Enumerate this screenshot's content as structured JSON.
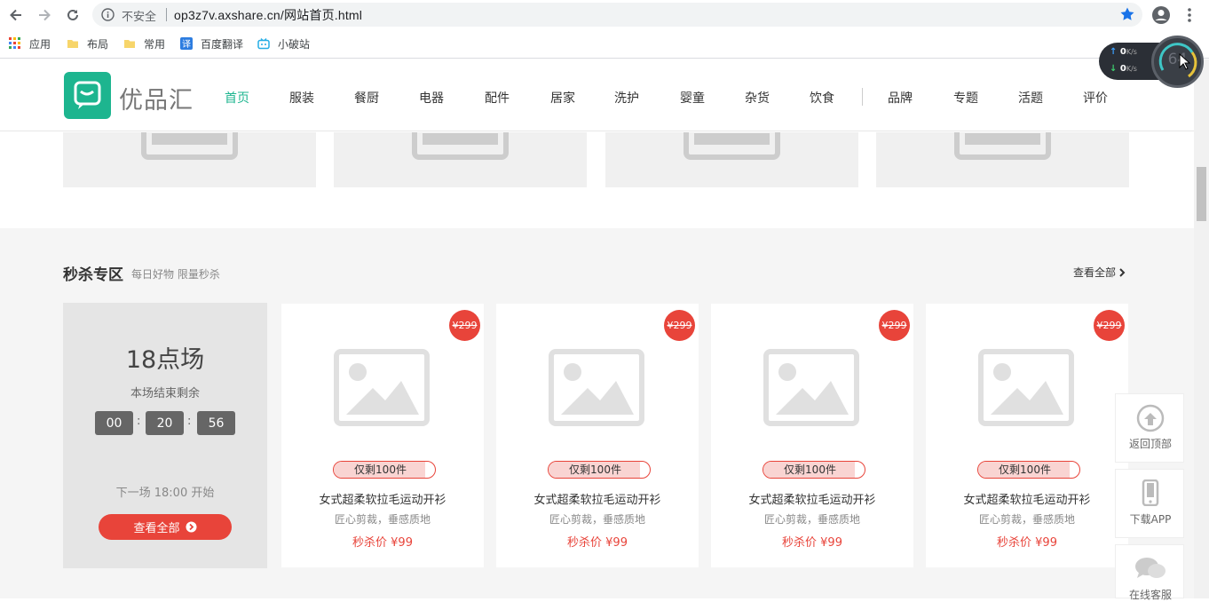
{
  "browser": {
    "insecure_label": "不安全",
    "url": "op3z7v.axshare.cn/网站首页.html",
    "bookmarks": [
      {
        "label": "应用",
        "icon": "apps-grid-icon"
      },
      {
        "label": "布局",
        "icon": "folder-icon"
      },
      {
        "label": "常用",
        "icon": "folder-icon"
      },
      {
        "label": "百度翻译",
        "icon": "translate-icon"
      },
      {
        "label": "小破站",
        "icon": "bilibili-icon"
      }
    ],
    "net_up": "0",
    "net_down": "0",
    "net_unit": "K/s",
    "net_dial_value": "64"
  },
  "site": {
    "logo_text": "优品汇",
    "nav": [
      "首页",
      "服装",
      "餐厨",
      "电器",
      "配件",
      "居家",
      "洗护",
      "婴童",
      "杂货",
      "饮食",
      "品牌",
      "专题",
      "活题",
      "评价"
    ],
    "active_nav": "首页"
  },
  "flash": {
    "title": "秒杀专区",
    "subtitle": "每日好物 限量秒杀",
    "view_all": "查看全部",
    "session": "18点场",
    "remain_label": "本场结束剩余",
    "countdown": {
      "h": "00",
      "m": "20",
      "s": "56"
    },
    "next_session": "下一场 18:00 开始",
    "button_label": "查看全部",
    "products": [
      {
        "orig_price": "¥299",
        "stock": "仅剩100件",
        "stock_fill": 0.9,
        "name": "女式超柔软拉毛运动开衫",
        "desc": "匠心剪裁，垂感质地",
        "price": "秒杀价 ¥99"
      },
      {
        "orig_price": "¥299",
        "stock": "仅剩100件",
        "stock_fill": 0.9,
        "name": "女式超柔软拉毛运动开衫",
        "desc": "匠心剪裁，垂感质地",
        "price": "秒杀价 ¥99"
      },
      {
        "orig_price": "¥299",
        "stock": "仅剩100件",
        "stock_fill": 0.9,
        "name": "女式超柔软拉毛运动开衫",
        "desc": "匠心剪裁，垂感质地",
        "price": "秒杀价 ¥99"
      },
      {
        "orig_price": "¥299",
        "stock": "仅剩100件",
        "stock_fill": 0.9,
        "name": "女式超柔软拉毛运动开衫",
        "desc": "匠心剪裁，垂感质地",
        "price": "秒杀价 ¥99"
      }
    ]
  },
  "side_tools": [
    {
      "label": "返回顶部",
      "icon": "arrow-up-circle-icon"
    },
    {
      "label": "下载APP",
      "icon": "phone-icon"
    },
    {
      "label": "在线客服",
      "icon": "chat-bubbles-icon"
    }
  ],
  "colors": {
    "brand": "#1db58f",
    "accent": "#e8443a"
  }
}
